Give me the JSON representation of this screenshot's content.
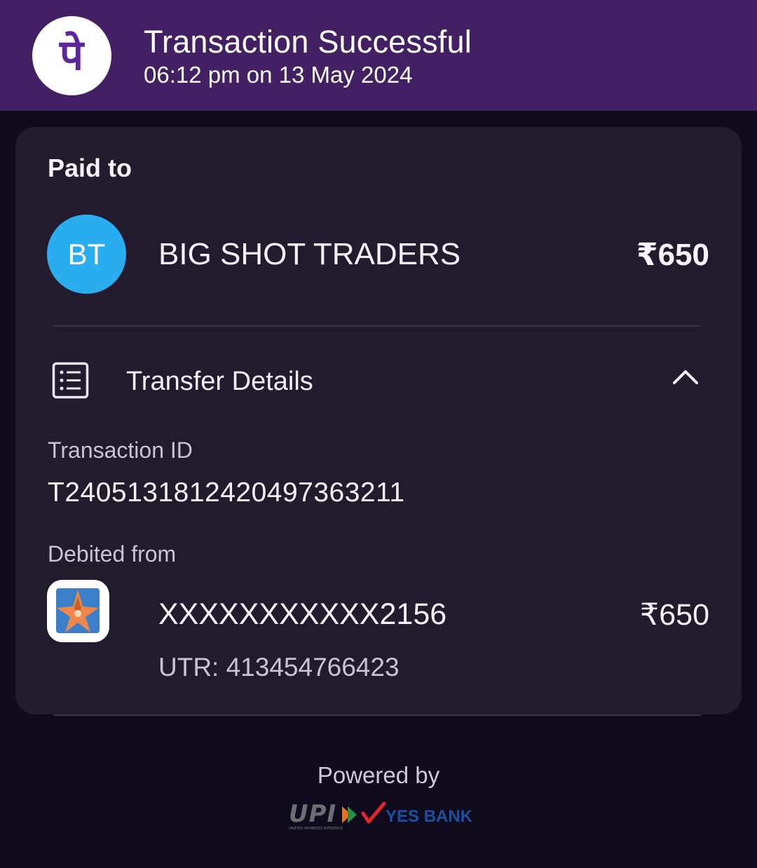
{
  "header": {
    "logo_icon": "phonepe-logo-icon",
    "logo_glyph": "पे",
    "title": "Transaction Successful",
    "subtitle": "06:12 pm on 13 May 2024"
  },
  "card": {
    "paid_to_label": "Paid to",
    "payee": {
      "initials": "BT",
      "name": "BIG SHOT TRADERS",
      "amount": "₹650"
    },
    "transfer_details": {
      "icon": "receipt-list-icon",
      "label": "Transfer Details",
      "toggle_icon": "chevron-up-icon",
      "expanded": true
    },
    "transaction_id": {
      "label": "Transaction ID",
      "value": "T2405131812420497363211"
    },
    "debited_from": {
      "label": "Debited from",
      "bank_icon": "bank-star-icon",
      "account": "XXXXXXXXXXX2156",
      "amount": "₹650",
      "utr": "UTR: 413454766423"
    }
  },
  "footer": {
    "powered_by": "Powered by",
    "upi_text": "UPI",
    "upi_tagline": "UNIFIED PAYMENTS INTERFACE",
    "bank_text": "YES BANK"
  },
  "colors": {
    "header_bg": "#432064",
    "page_bg": "#0f0a1c",
    "card_bg": "#221b2e",
    "brand_purple": "#5f259f",
    "avatar_blue": "#2aaef0",
    "yes_bank_blue": "#1b4fa0",
    "yes_bank_red": "#e3262e"
  }
}
